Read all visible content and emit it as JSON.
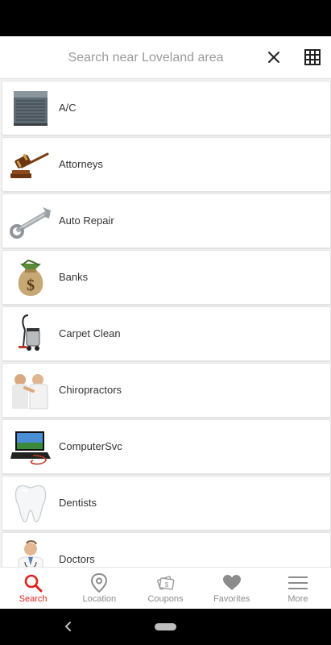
{
  "search": {
    "placeholder": "Search near Loveland area"
  },
  "categories": [
    {
      "label": "A/C",
      "icon": "ac-unit-icon"
    },
    {
      "label": "Attorneys",
      "icon": "gavel-icon"
    },
    {
      "label": "Auto Repair",
      "icon": "wrench-icon"
    },
    {
      "label": "Banks",
      "icon": "money-bag-icon"
    },
    {
      "label": "Carpet Clean",
      "icon": "vacuum-icon"
    },
    {
      "label": "Chiropractors",
      "icon": "chiropractor-icon"
    },
    {
      "label": "ComputerSvc",
      "icon": "laptop-icon"
    },
    {
      "label": "Dentists",
      "icon": "tooth-icon"
    },
    {
      "label": "Doctors",
      "icon": "doctor-icon"
    }
  ],
  "nav": [
    {
      "label": "Search",
      "icon": "search-icon",
      "active": true
    },
    {
      "label": "Location",
      "icon": "location-pin-icon",
      "active": false
    },
    {
      "label": "Coupons",
      "icon": "coupons-icon",
      "active": false
    },
    {
      "label": "Favorites",
      "icon": "heart-icon",
      "active": false
    },
    {
      "label": "More",
      "icon": "menu-icon",
      "active": false
    }
  ],
  "colors": {
    "accent": "#e0231f",
    "inactive": "#8c8c8c",
    "text": "#333333"
  }
}
